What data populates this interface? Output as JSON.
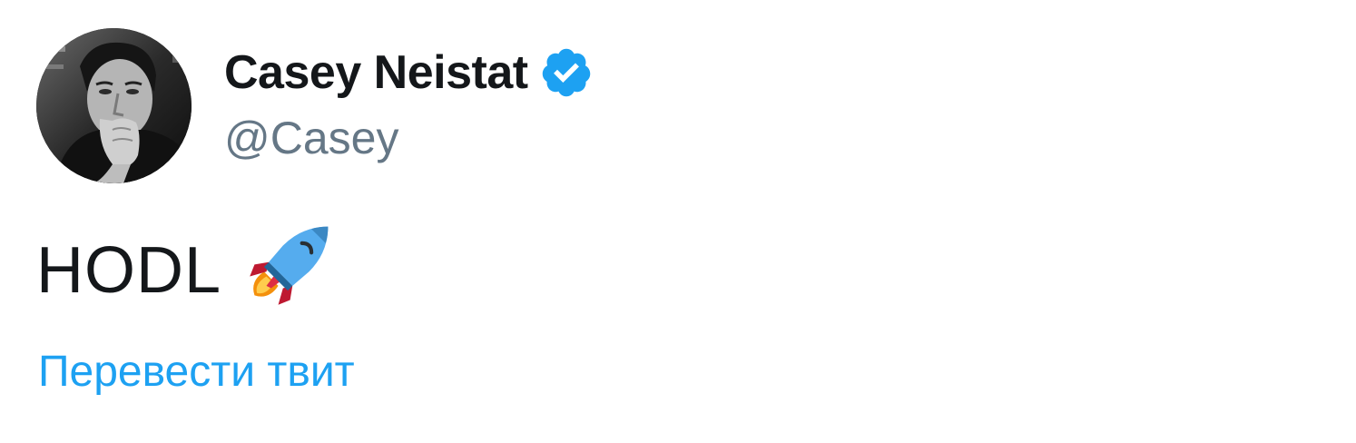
{
  "tweet": {
    "author": {
      "display_name": "Casey Neistat",
      "handle": "@Casey",
      "verified": true,
      "avatar_icon": "avatar-photo"
    },
    "text": "HODL",
    "emoji": "rocket-icon",
    "translate_label": "Перевести твит"
  },
  "colors": {
    "name": "#14171a",
    "handle": "#657786",
    "link": "#1da1f2",
    "verified": "#1da1f2"
  }
}
